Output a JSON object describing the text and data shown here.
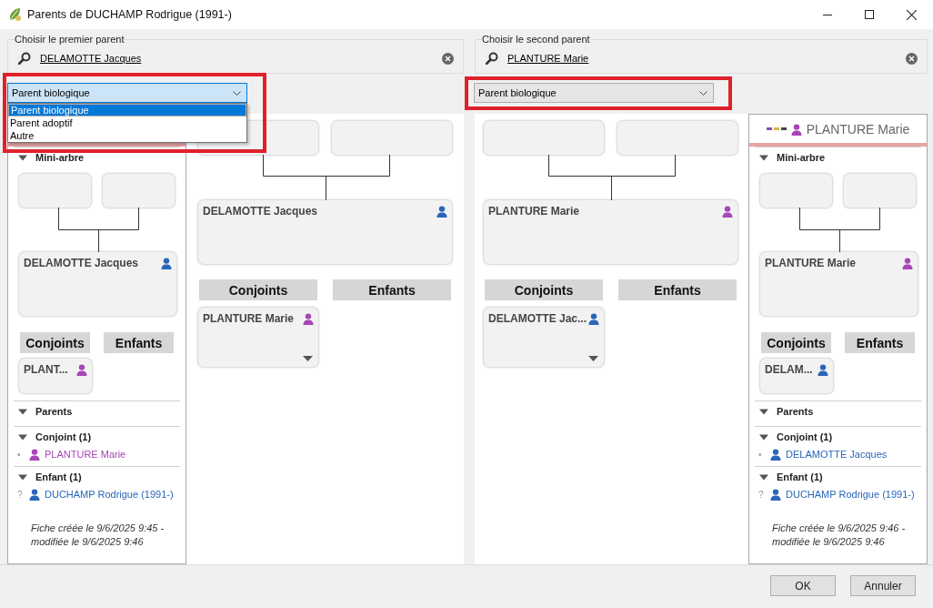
{
  "window": {
    "title": "Parents de DUCHAMP Rodrigue (1991-)"
  },
  "panes": [
    {
      "picker": {
        "label": "Choisir le premier parent",
        "value": "DELAMOTTE Jacques"
      },
      "relation": {
        "value": "Parent biologique",
        "focused": true,
        "highlighted": true,
        "open": true,
        "options": [
          {
            "label": "Parent biologique",
            "selected": true
          },
          {
            "label": "Parent adoptif",
            "selected": false
          },
          {
            "label": "Autre",
            "selected": false
          }
        ]
      },
      "card_first": true,
      "tree": {
        "person": {
          "name": "DELAMOTTE Jacques",
          "color": "#2a66b8"
        },
        "buttons": [
          "Conjoints",
          "Enfants"
        ],
        "spouses": [
          {
            "name": "PLANTURE Marie",
            "color": "#a845b8"
          }
        ]
      },
      "card": {
        "sections": [
          {
            "kind": "tree",
            "title": "Mini-arbre",
            "expanded": true,
            "person": {
              "name": "DELAMOTTE Jacques",
              "color": "#2a66b8"
            },
            "buttons": [
              "Conjoints",
              "Enfants"
            ],
            "spouses": [
              {
                "name": "PLANT...",
                "color": "#a845b8"
              }
            ]
          },
          {
            "kind": "list",
            "title": "Parents",
            "expanded": true
          },
          {
            "kind": "list",
            "title": "Conjoint (1)",
            "expanded": true,
            "items": [
              {
                "marker": "•",
                "name": "PLANTURE Marie",
                "color": "#a845b8"
              }
            ]
          },
          {
            "kind": "list",
            "title": "Enfant (1)",
            "expanded": true,
            "items": [
              {
                "marker": "?",
                "name": "DUCHAMP Rodrigue (1991-)",
                "color": "#2a66b8"
              }
            ]
          }
        ],
        "footnote": "Fiche créée le 9/6/2025 9:45 - modifiée le 9/6/2025 9:46"
      }
    },
    {
      "picker": {
        "label": "Choisir le second parent",
        "value": "PLANTURE Marie"
      },
      "relation": {
        "value": "Parent biologique",
        "focused": false,
        "highlighted": true,
        "open": false
      },
      "card_first": false,
      "tree": {
        "person": {
          "name": "PLANTURE Marie",
          "color": "#a845b8"
        },
        "buttons": [
          "Conjoints",
          "Enfants"
        ],
        "spouses": [
          {
            "name": "DELAMOTTE Jac...",
            "color": "#2a66b8"
          }
        ]
      },
      "card": {
        "header": {
          "name": "PLANTURE Marie",
          "color": "#a845b8"
        },
        "sections": [
          {
            "kind": "tree",
            "title": "Mini-arbre",
            "expanded": true,
            "person": {
              "name": "PLANTURE Marie",
              "color": "#a845b8"
            },
            "buttons": [
              "Conjoints",
              "Enfants"
            ],
            "spouses": [
              {
                "name": "DELAM...",
                "color": "#2a66b8"
              }
            ]
          },
          {
            "kind": "list",
            "title": "Parents",
            "expanded": true
          },
          {
            "kind": "list",
            "title": "Conjoint (1)",
            "expanded": true,
            "items": [
              {
                "marker": "•",
                "name": "DELAMOTTE Jacques",
                "color": "#2a66b8"
              }
            ]
          },
          {
            "kind": "list",
            "title": "Enfant (1)",
            "expanded": true,
            "items": [
              {
                "marker": "?",
                "name": "DUCHAMP Rodrigue (1991-)",
                "color": "#2a66b8"
              }
            ]
          }
        ],
        "footnote": "Fiche créée le 9/6/2025 9:46 - modifiée le 9/6/2025 9:46"
      }
    }
  ],
  "buttons": [
    "OK",
    "Annuler"
  ]
}
